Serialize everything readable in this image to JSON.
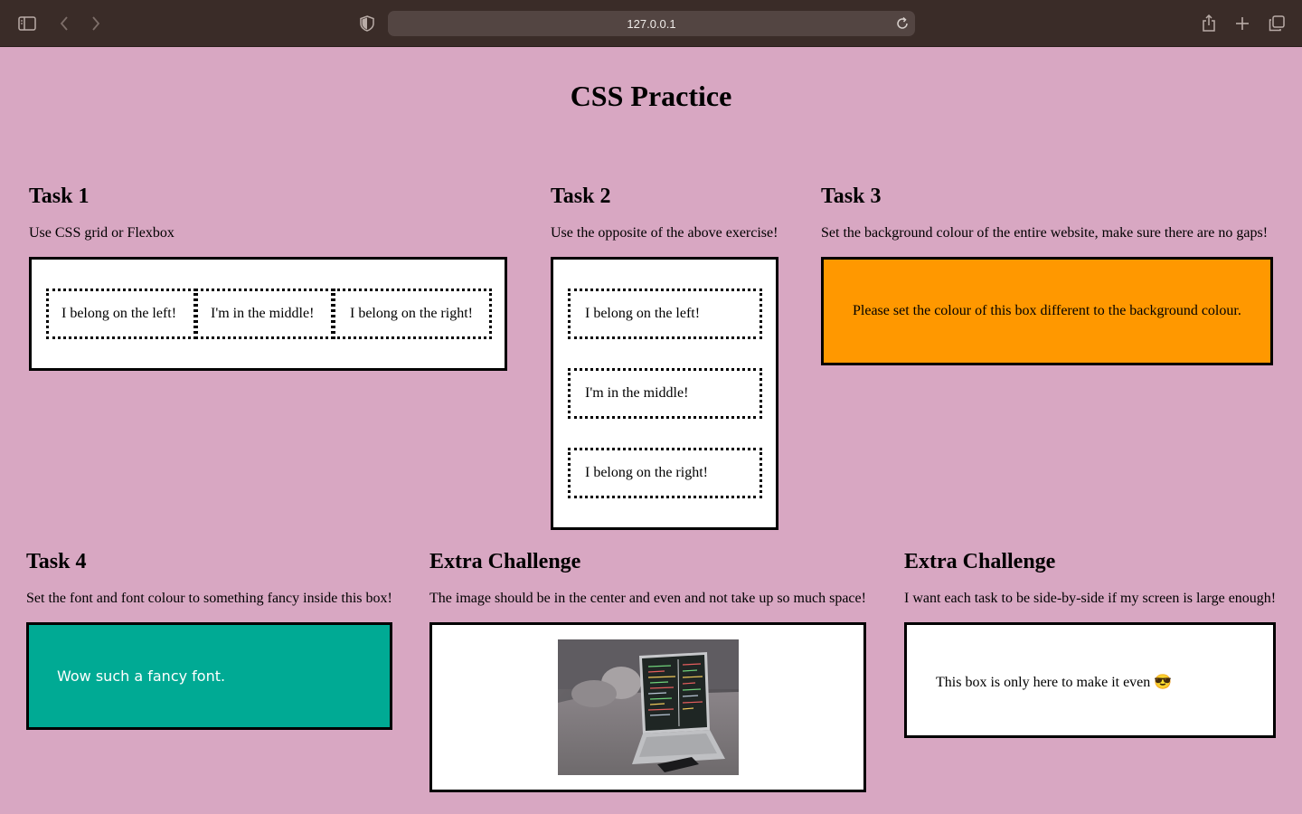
{
  "browser": {
    "url": "127.0.0.1",
    "icons": {
      "sidebar": "sidebar-icon",
      "back": "chevron-left-icon",
      "forward": "chevron-right-icon",
      "privacy": "shield-icon",
      "reload": "reload-icon",
      "share": "share-icon",
      "new_tab": "plus-icon",
      "tabs": "tab-overview-icon"
    }
  },
  "page": {
    "title": "CSS Practice",
    "background": "#d8a7c2"
  },
  "task1": {
    "heading": "Task 1",
    "description": "Use CSS grid or Flexbox",
    "items": [
      "I belong on the left!",
      "I'm in the middle!",
      "I belong on the right!"
    ]
  },
  "task2": {
    "heading": "Task 2",
    "description": "Use the opposite of the above exercise!",
    "items": [
      "I belong on the left!",
      "I'm in the middle!",
      "I belong on the right!"
    ]
  },
  "task3": {
    "heading": "Task 3",
    "description": "Set the background colour of the entire website, make sure there are no gaps!",
    "box_text": "Please set the colour of this box different to the background colour.",
    "box_color": "#ff9800"
  },
  "task4": {
    "heading": "Task 4",
    "description": "Set the font and font colour to something fancy inside this box!",
    "box_text": "Wow such a fancy font.",
    "box_color": "#00aa94"
  },
  "extra1": {
    "heading": "Extra Challenge",
    "description": "The image should be in the center and even and not take up so much space!"
  },
  "extra2": {
    "heading": "Extra Challenge",
    "description": "I want each task to be side-by-side if my screen is large enough!",
    "box_text": "This box is only here to make it even 😎"
  }
}
